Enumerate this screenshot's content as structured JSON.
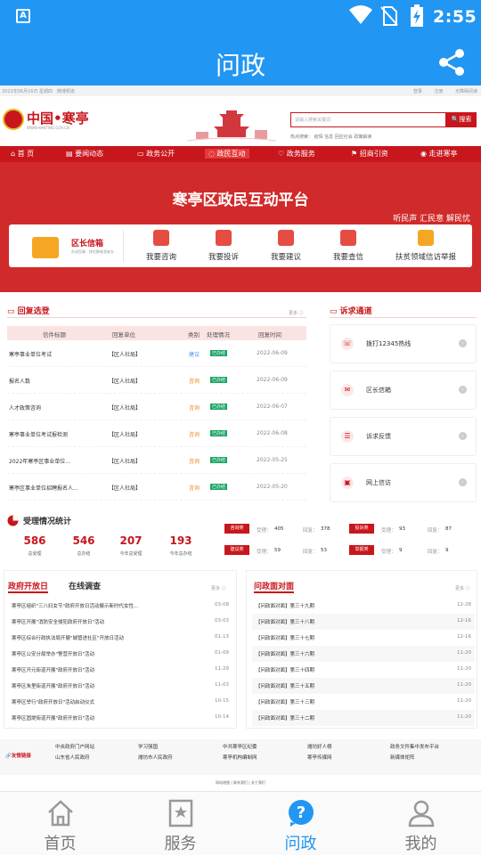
{
  "status_bar": {
    "app_glyph": "A",
    "time": "2:55"
  },
  "app_bar": {
    "title": "问政"
  },
  "web": {
    "top_strip": {
      "date": "2022年06月16日 星期四",
      "wb": "微博频道",
      "links": "登录 注册 无障碍阅读"
    },
    "logo": {
      "text": "中国•寒亭",
      "sub": "WWW.HANTING.GOV.CN"
    },
    "search": {
      "placeholder": "请输入搜索关键词",
      "button": "搜索",
      "hot": "热点搜索：  疫情 信息 回应社会  政策解读"
    },
    "nav": [
      "首 页",
      "要闻动态",
      "政务公开",
      "政民互动",
      "政务服务",
      "招商引资",
      "走进寒亭"
    ],
    "banner": {
      "title": "寒亭区政民互动平台",
      "slogan": "听民声 汇民意 解民忧",
      "mailbox": {
        "title": "区长信箱",
        "sub": "办成您事 · 排忧解难我来办"
      },
      "items": [
        "我要咨询",
        "我要投诉",
        "我要建议",
        "我要查信",
        "扶贫领域信访举报"
      ]
    },
    "reply": {
      "title": "回复选登",
      "more": "更多",
      "headers": [
        "信件标题",
        "回复单位",
        "类别",
        "处理情况",
        "回复时间"
      ],
      "rows": [
        {
          "title": "寒亭事业单位考试",
          "unit": "【区人社局】",
          "type": "建议",
          "status": "已办结",
          "date": "2022-06-09",
          "tcls": "j"
        },
        {
          "title": "报名人数",
          "unit": "【区人社局】",
          "type": "咨询",
          "status": "已办结",
          "date": "2022-06-09",
          "tcls": "z"
        },
        {
          "title": "人才政策咨询",
          "unit": "【区人社局】",
          "type": "咨询",
          "status": "已办结",
          "date": "2022-06-07",
          "tcls": "z"
        },
        {
          "title": "寒亭事业单位考试报检测",
          "unit": "【区人社局】",
          "type": "咨询",
          "status": "已办结",
          "date": "2022-06-08",
          "tcls": "z"
        },
        {
          "title": "2022年寒亭区事业单位...",
          "unit": "【区人社局】",
          "type": "咨询",
          "status": "已办结",
          "date": "2022-05-25",
          "tcls": "z"
        },
        {
          "title": "寒亭区事业单位招聘报名人...",
          "unit": "【区人社局】",
          "type": "咨询",
          "status": "已办结",
          "date": "2022-05-20",
          "tcls": "z"
        }
      ]
    },
    "channel": {
      "title": "诉求通道",
      "items": [
        {
          "icon": "phone-icon",
          "glyph": "☏",
          "label": "拨打12345热线"
        },
        {
          "icon": "mail-icon",
          "glyph": "✉",
          "label": "区长信箱"
        },
        {
          "icon": "feedback-icon",
          "glyph": "☰",
          "label": "诉求反馈"
        },
        {
          "icon": "petition-icon",
          "glyph": "▣",
          "label": "网上信访"
        }
      ]
    },
    "stats": {
      "title": "受理情况统计",
      "nums": [
        {
          "v": "586",
          "l": "总受理"
        },
        {
          "v": "546",
          "l": "总办结"
        },
        {
          "v": "207",
          "l": "今年总受理"
        },
        {
          "v": "193",
          "l": "今年总办结"
        }
      ],
      "cats": [
        {
          "tag": "咨询类",
          "a_l": "受理：",
          "a": "405",
          "b_l": "回复：",
          "b": "378"
        },
        {
          "tag": "投诉类",
          "a_l": "受理：",
          "a": "93",
          "b_l": "回复：",
          "b": "87"
        },
        {
          "tag": "建议类",
          "a_l": "受理：",
          "a": "59",
          "b_l": "回复：",
          "b": "53"
        },
        {
          "tag": "举报类",
          "a_l": "受理：",
          "a": "9",
          "b_l": "回复：",
          "b": "9"
        }
      ]
    },
    "open_day": {
      "tab_active": "政府开放日",
      "tab_other": "在线调查",
      "more": "更多",
      "items": [
        {
          "t": "寒亭区组织\"三八妇女节\"政府开放日活动展示新时代女性...",
          "d": "03-08"
        },
        {
          "t": "寒亭区开展\"消防安全侵犯政府开放日\"活动",
          "d": "03-03"
        },
        {
          "t": "寒亭区综合行政执法局开展\"城管进社区\"开放日活动",
          "d": "01-13"
        },
        {
          "t": "寒亭区公安分局举办\"警营开放日\"活动",
          "d": "01-09"
        },
        {
          "t": "寒亭区开元街道开展\"政府开放日\"活动",
          "d": "11-29"
        },
        {
          "t": "寒亭区朱里街道开展\"政府开放日\"活动",
          "d": "11-03"
        },
        {
          "t": "寒亭区举行\"政府开放日\"活动启动仪式",
          "d": "10-15"
        },
        {
          "t": "寒亭区固堤街道开展\"政府开放日\"活动",
          "d": "10-14"
        }
      ]
    },
    "face": {
      "title": "问政面对面",
      "more": "更多",
      "items": [
        {
          "t": "【问政面对面】第三十九期",
          "d": "12-28"
        },
        {
          "t": "【问政面对面】第三十八期",
          "d": "12-16"
        },
        {
          "t": "【问政面对面】第三十七期",
          "d": "12-16"
        },
        {
          "t": "【问政面对面】第三十六期",
          "d": "11-20"
        },
        {
          "t": "【问政面对面】第三十四期",
          "d": "11-20"
        },
        {
          "t": "【问政面对面】第三十五期",
          "d": "11-20"
        },
        {
          "t": "【问政面对面】第三十三期",
          "d": "11-20"
        },
        {
          "t": "【问政面对面】第三十二期",
          "d": "11-20"
        }
      ]
    },
    "links": {
      "label": "友情链接",
      "items": [
        "中央政府门户网站",
        "学习强国",
        "中共寒亭区纪委",
        "潍坊好人榜",
        "政务文件集中发布平台",
        "山东省人民政府",
        "潍坊市人民政府",
        "寒亭机构编制网",
        "寒亭传媒网",
        "新媒体矩阵"
      ]
    },
    "footer": "网站地图  |  联系我们  |  关于我们"
  },
  "bottom_nav": [
    {
      "label": "首页",
      "icon": "home-icon"
    },
    {
      "label": "服务",
      "icon": "service-icon"
    },
    {
      "label": "问政",
      "icon": "inquiry-icon"
    },
    {
      "label": "我的",
      "icon": "profile-icon"
    }
  ],
  "colors": {
    "primary": "#2196f3",
    "accent": "#c8161d"
  }
}
